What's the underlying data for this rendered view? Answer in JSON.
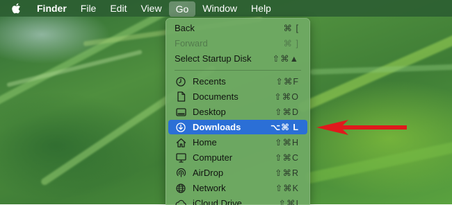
{
  "menubar": {
    "app_name": "Finder",
    "items": [
      {
        "label": "File"
      },
      {
        "label": "Edit"
      },
      {
        "label": "View"
      },
      {
        "label": "Go"
      },
      {
        "label": "Window"
      },
      {
        "label": "Help"
      }
    ],
    "open_menu": "Go"
  },
  "go_menu": {
    "items": [
      {
        "label": "Back",
        "shortcut": "⌘ [",
        "enabled": true
      },
      {
        "label": "Forward",
        "shortcut": "⌘ ]",
        "enabled": false
      },
      {
        "label": "Select Startup Disk",
        "shortcut": "⇧⌘▲",
        "enabled": true
      },
      {
        "label": "Recents",
        "shortcut": "⇧⌘F",
        "icon": "clock-icon"
      },
      {
        "label": "Documents",
        "shortcut": "⇧⌘O",
        "icon": "document-icon"
      },
      {
        "label": "Desktop",
        "shortcut": "⇧⌘D",
        "icon": "desktop-icon"
      },
      {
        "label": "Downloads",
        "shortcut": "⌥⌘ L",
        "icon": "download-icon",
        "selected": true
      },
      {
        "label": "Home",
        "shortcut": "⇧⌘H",
        "icon": "home-icon"
      },
      {
        "label": "Computer",
        "shortcut": "⇧⌘C",
        "icon": "computer-icon"
      },
      {
        "label": "AirDrop",
        "shortcut": "⇧⌘R",
        "icon": "airdrop-icon"
      },
      {
        "label": "Network",
        "shortcut": "⇧⌘K",
        "icon": "globe-icon"
      },
      {
        "label": "iCloud Drive",
        "shortcut": "⇧⌘I",
        "icon": "cloud-icon"
      }
    ]
  },
  "colors": {
    "highlight": "#2b6fd6",
    "arrow": "#e0191c"
  }
}
